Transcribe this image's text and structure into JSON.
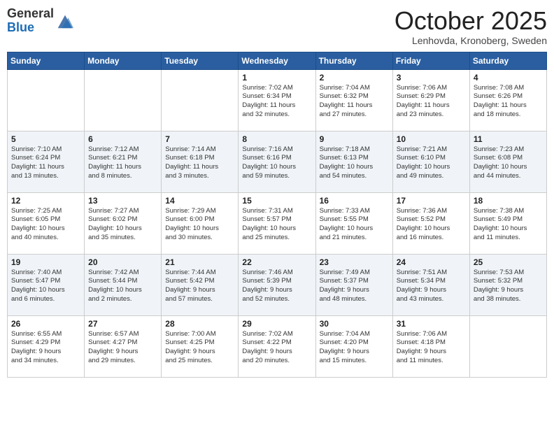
{
  "logo": {
    "general": "General",
    "blue": "Blue"
  },
  "header": {
    "month": "October 2025",
    "location": "Lenhovda, Kronoberg, Sweden"
  },
  "weekdays": [
    "Sunday",
    "Monday",
    "Tuesday",
    "Wednesday",
    "Thursday",
    "Friday",
    "Saturday"
  ],
  "weeks": [
    [
      {
        "day": "",
        "info": ""
      },
      {
        "day": "",
        "info": ""
      },
      {
        "day": "",
        "info": ""
      },
      {
        "day": "1",
        "info": "Sunrise: 7:02 AM\nSunset: 6:34 PM\nDaylight: 11 hours\nand 32 minutes."
      },
      {
        "day": "2",
        "info": "Sunrise: 7:04 AM\nSunset: 6:32 PM\nDaylight: 11 hours\nand 27 minutes."
      },
      {
        "day": "3",
        "info": "Sunrise: 7:06 AM\nSunset: 6:29 PM\nDaylight: 11 hours\nand 23 minutes."
      },
      {
        "day": "4",
        "info": "Sunrise: 7:08 AM\nSunset: 6:26 PM\nDaylight: 11 hours\nand 18 minutes."
      }
    ],
    [
      {
        "day": "5",
        "info": "Sunrise: 7:10 AM\nSunset: 6:24 PM\nDaylight: 11 hours\nand 13 minutes."
      },
      {
        "day": "6",
        "info": "Sunrise: 7:12 AM\nSunset: 6:21 PM\nDaylight: 11 hours\nand 8 minutes."
      },
      {
        "day": "7",
        "info": "Sunrise: 7:14 AM\nSunset: 6:18 PM\nDaylight: 11 hours\nand 3 minutes."
      },
      {
        "day": "8",
        "info": "Sunrise: 7:16 AM\nSunset: 6:16 PM\nDaylight: 10 hours\nand 59 minutes."
      },
      {
        "day": "9",
        "info": "Sunrise: 7:18 AM\nSunset: 6:13 PM\nDaylight: 10 hours\nand 54 minutes."
      },
      {
        "day": "10",
        "info": "Sunrise: 7:21 AM\nSunset: 6:10 PM\nDaylight: 10 hours\nand 49 minutes."
      },
      {
        "day": "11",
        "info": "Sunrise: 7:23 AM\nSunset: 6:08 PM\nDaylight: 10 hours\nand 44 minutes."
      }
    ],
    [
      {
        "day": "12",
        "info": "Sunrise: 7:25 AM\nSunset: 6:05 PM\nDaylight: 10 hours\nand 40 minutes."
      },
      {
        "day": "13",
        "info": "Sunrise: 7:27 AM\nSunset: 6:02 PM\nDaylight: 10 hours\nand 35 minutes."
      },
      {
        "day": "14",
        "info": "Sunrise: 7:29 AM\nSunset: 6:00 PM\nDaylight: 10 hours\nand 30 minutes."
      },
      {
        "day": "15",
        "info": "Sunrise: 7:31 AM\nSunset: 5:57 PM\nDaylight: 10 hours\nand 25 minutes."
      },
      {
        "day": "16",
        "info": "Sunrise: 7:33 AM\nSunset: 5:55 PM\nDaylight: 10 hours\nand 21 minutes."
      },
      {
        "day": "17",
        "info": "Sunrise: 7:36 AM\nSunset: 5:52 PM\nDaylight: 10 hours\nand 16 minutes."
      },
      {
        "day": "18",
        "info": "Sunrise: 7:38 AM\nSunset: 5:49 PM\nDaylight: 10 hours\nand 11 minutes."
      }
    ],
    [
      {
        "day": "19",
        "info": "Sunrise: 7:40 AM\nSunset: 5:47 PM\nDaylight: 10 hours\nand 6 minutes."
      },
      {
        "day": "20",
        "info": "Sunrise: 7:42 AM\nSunset: 5:44 PM\nDaylight: 10 hours\nand 2 minutes."
      },
      {
        "day": "21",
        "info": "Sunrise: 7:44 AM\nSunset: 5:42 PM\nDaylight: 9 hours\nand 57 minutes."
      },
      {
        "day": "22",
        "info": "Sunrise: 7:46 AM\nSunset: 5:39 PM\nDaylight: 9 hours\nand 52 minutes."
      },
      {
        "day": "23",
        "info": "Sunrise: 7:49 AM\nSunset: 5:37 PM\nDaylight: 9 hours\nand 48 minutes."
      },
      {
        "day": "24",
        "info": "Sunrise: 7:51 AM\nSunset: 5:34 PM\nDaylight: 9 hours\nand 43 minutes."
      },
      {
        "day": "25",
        "info": "Sunrise: 7:53 AM\nSunset: 5:32 PM\nDaylight: 9 hours\nand 38 minutes."
      }
    ],
    [
      {
        "day": "26",
        "info": "Sunrise: 6:55 AM\nSunset: 4:29 PM\nDaylight: 9 hours\nand 34 minutes."
      },
      {
        "day": "27",
        "info": "Sunrise: 6:57 AM\nSunset: 4:27 PM\nDaylight: 9 hours\nand 29 minutes."
      },
      {
        "day": "28",
        "info": "Sunrise: 7:00 AM\nSunset: 4:25 PM\nDaylight: 9 hours\nand 25 minutes."
      },
      {
        "day": "29",
        "info": "Sunrise: 7:02 AM\nSunset: 4:22 PM\nDaylight: 9 hours\nand 20 minutes."
      },
      {
        "day": "30",
        "info": "Sunrise: 7:04 AM\nSunset: 4:20 PM\nDaylight: 9 hours\nand 15 minutes."
      },
      {
        "day": "31",
        "info": "Sunrise: 7:06 AM\nSunset: 4:18 PM\nDaylight: 9 hours\nand 11 minutes."
      },
      {
        "day": "",
        "info": ""
      }
    ]
  ]
}
